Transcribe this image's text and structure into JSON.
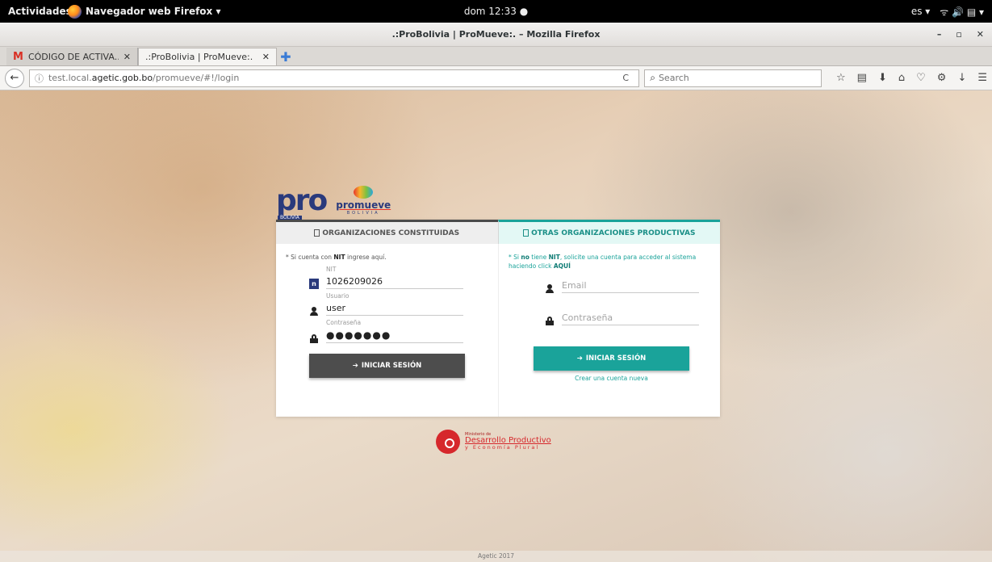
{
  "system": {
    "activities": "Actividades",
    "app_name": "Navegador web Firefox ▾",
    "clock": "dom 12:33 ●",
    "lang": "es ▾",
    "status_icons": "ᯤ 🔊 ▤ ▾"
  },
  "window": {
    "title": ".:ProBolivia | ProMueve:. – Mozilla Firefox",
    "minimize": "–",
    "maximize": "▫",
    "close": "✕"
  },
  "tabs": [
    {
      "favicon": "M",
      "title": "CÓDIGO DE ACTIVA...",
      "close": "✕"
    },
    {
      "title": ".:ProBolivia | ProMueve:.",
      "close": "✕"
    }
  ],
  "newtab": "✚",
  "navbar": {
    "url_prefix": "test.local.",
    "url_domain": "agetic.gob.bo",
    "url_path": "/promueve/#!/login",
    "reload": "C",
    "search_placeholder": "Search"
  },
  "logos": {
    "pro": "pro",
    "pro_sub": "BOLIVIA",
    "promueve": "promueve",
    "promueve_sub": "BOLIVIA"
  },
  "card": {
    "tab_left": "ORGANIZACIONES CONSTITUIDAS",
    "tab_right": "OTRAS ORGANIZACIONES PRODUCTIVAS",
    "left": {
      "note_pre": "* Si cuenta con ",
      "note_bold": "NIT",
      "note_post": " ingrese aquí.",
      "nit_label": "NIT",
      "nit_value": "1026209026",
      "user_label": "Usuario",
      "user_value": "user",
      "pass_label": "Contraseña",
      "pass_value": "●●●●●●●",
      "button": "INICIAR SESIÓN"
    },
    "right": {
      "note_pre": "* Si ",
      "note_no": "no",
      "note_mid": " tiene ",
      "note_nit": "NIT",
      "note_post": ", solicite una cuenta para acceder al sistema haciendo click ",
      "note_aqui": "AQUÍ",
      "email_placeholder": "Email",
      "pass_placeholder": "Contraseña",
      "button": "INICIAR SESIÓN",
      "create": "Crear una cuenta nueva"
    }
  },
  "ministry": {
    "line1": "Ministerio de",
    "line2": "Desarrollo Productivo",
    "line3": "y Economía Plural"
  },
  "footer": "Agetic 2017"
}
